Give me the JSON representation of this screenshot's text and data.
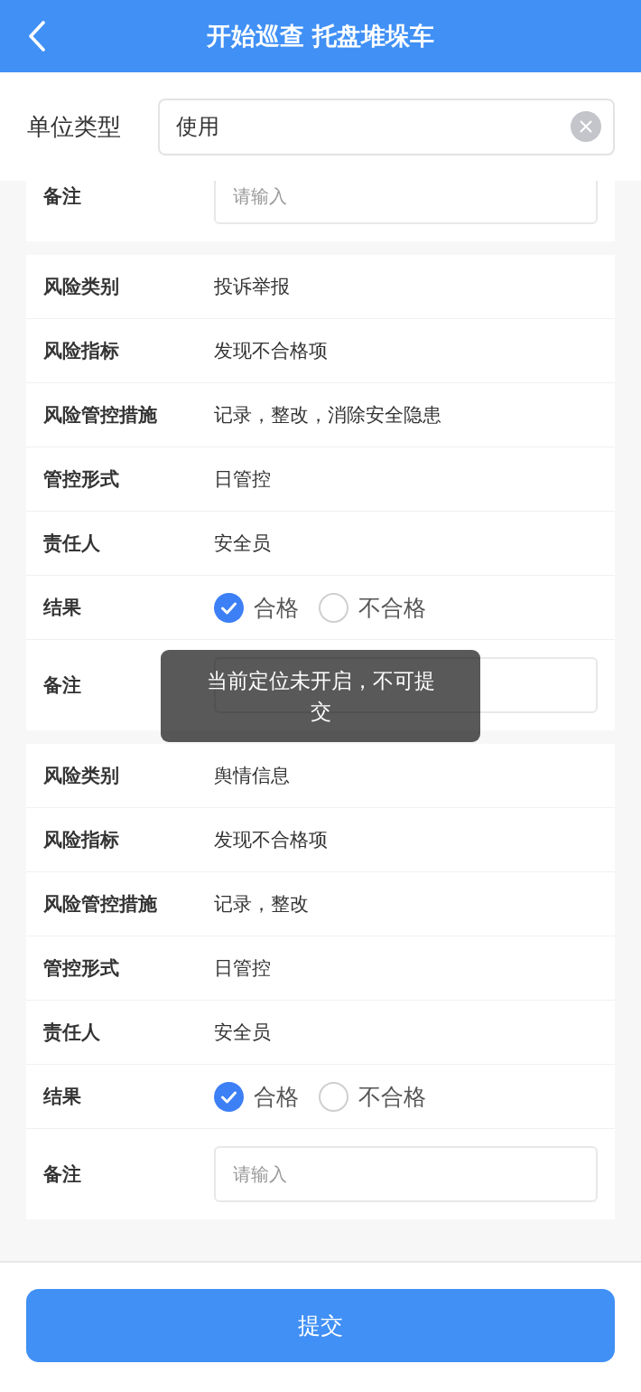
{
  "header": {
    "title": "开始巡查 托盘堆垛车"
  },
  "unit_type": {
    "label": "单位类型",
    "value": "使用"
  },
  "cards": [
    {
      "rows": [
        {
          "kind": "input",
          "label": "备注",
          "placeholder": "请输入"
        }
      ]
    },
    {
      "rows": [
        {
          "kind": "text",
          "label": "风险类别",
          "value": "投诉举报"
        },
        {
          "kind": "text",
          "label": "风险指标",
          "value": "发现不合格项"
        },
        {
          "kind": "text",
          "label": "风险管控措施",
          "value": "记录，整改，消除安全隐患"
        },
        {
          "kind": "text",
          "label": "管控形式",
          "value": "日管控"
        },
        {
          "kind": "text",
          "label": "责任人",
          "value": "安全员"
        },
        {
          "kind": "radio",
          "label": "结果",
          "options": [
            {
              "label": "合格",
              "selected": true
            },
            {
              "label": "不合格",
              "selected": false
            }
          ]
        },
        {
          "kind": "input",
          "label": "备注"
        }
      ]
    },
    {
      "rows": [
        {
          "kind": "text",
          "label": "风险类别",
          "value": "舆情信息"
        },
        {
          "kind": "text",
          "label": "风险指标",
          "value": "发现不合格项"
        },
        {
          "kind": "text",
          "label": "风险管控措施",
          "value": "记录，整改"
        },
        {
          "kind": "text",
          "label": "管控形式",
          "value": "日管控"
        },
        {
          "kind": "text",
          "label": "责任人",
          "value": "安全员"
        },
        {
          "kind": "radio",
          "label": "结果",
          "options": [
            {
              "label": "合格",
              "selected": true
            },
            {
              "label": "不合格",
              "selected": false
            }
          ]
        },
        {
          "kind": "input",
          "label": "备注",
          "placeholder": "请输入"
        }
      ]
    }
  ],
  "toast": {
    "text": "当前定位未开启，不可提交"
  },
  "submit_button": {
    "label": "提交"
  }
}
